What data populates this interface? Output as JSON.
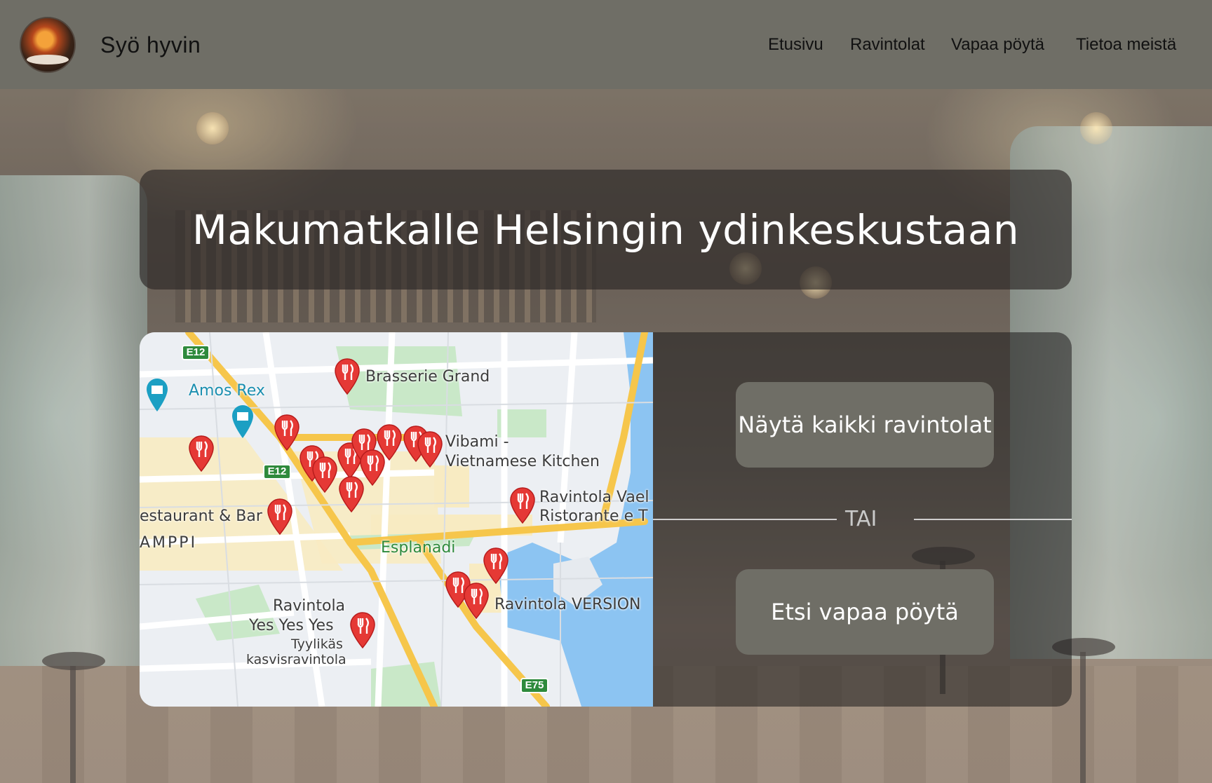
{
  "header": {
    "brand": "Syö hyvin",
    "nav": [
      "Etusivu",
      "Ravintolat",
      "Vapaa pöytä",
      "Tietoa meistä"
    ]
  },
  "hero": {
    "title": "Makumatkalle Helsingin ydinkeskustaan"
  },
  "map": {
    "labels": {
      "brasserie": "Brasserie Grand",
      "amos": "Amos Rex",
      "vibami1": "Vibami -",
      "vibami2": "Vietnamese Kitchen",
      "vael1": "Ravintola Vael",
      "vael2": "Ristorante e T",
      "restbar": "estaurant & Bar",
      "kampi": "AMPPI",
      "esplanadi": "Esplanadi",
      "yes1": "Ravintola",
      "yes2": "Yes Yes Yes",
      "yes3": "Tyylikäs",
      "yes4": "kasvisravintola",
      "version": "Ravintola VERSION"
    },
    "road_badges": [
      "E12",
      "E12",
      "E75"
    ]
  },
  "actions": {
    "show_all": "Näytä kaikki ravintolat",
    "or": "TAI",
    "find_table": "Etsi vapaa pöytä"
  },
  "colors": {
    "header_bg": "#6f6e66",
    "button_bg": "#6f6e66",
    "pin_red": "#e53935"
  }
}
